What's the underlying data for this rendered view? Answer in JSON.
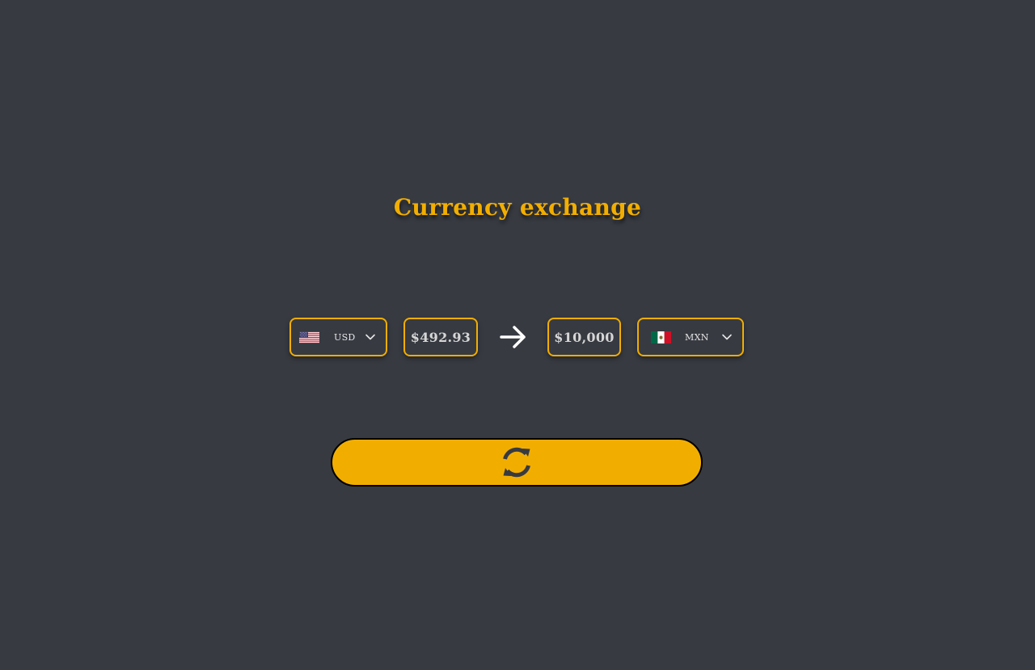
{
  "title": "Currency exchange",
  "from": {
    "currency_code": "USD",
    "flag_icon": "us-flag-icon",
    "amount": "$492.93"
  },
  "to": {
    "currency_code": "MXN",
    "flag_icon": "mx-flag-icon",
    "amount": "$10,000"
  },
  "direction_icon": "arrow-right-icon",
  "convert_button_icon": "refresh-icon",
  "colors": {
    "background": "#373a41",
    "accent": "#f2ae00",
    "text_light": "#e6e6e6",
    "button_icon": "#373a41"
  }
}
